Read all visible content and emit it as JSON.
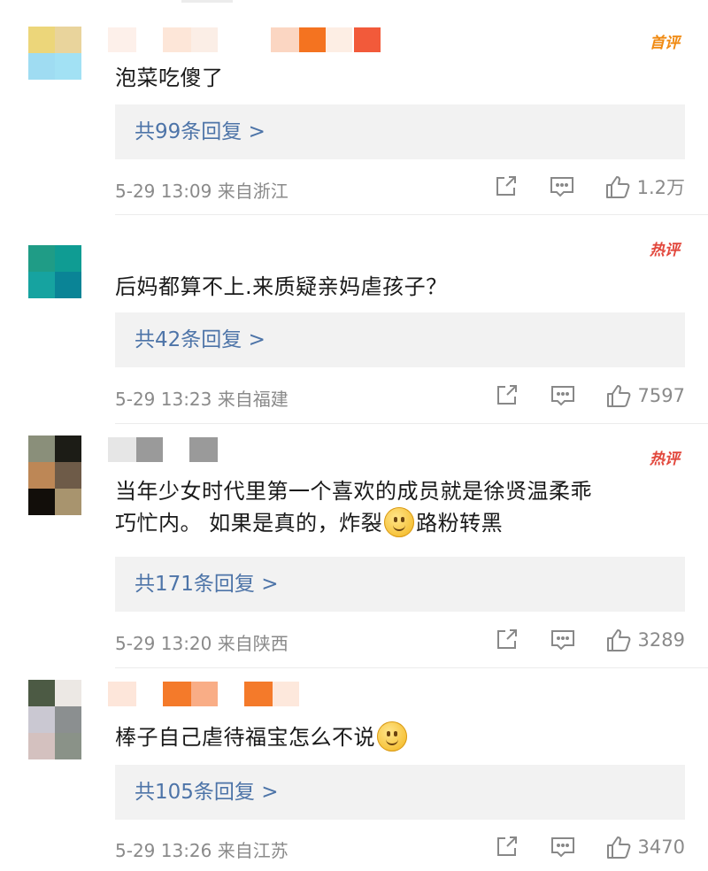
{
  "comments": [
    {
      "badge": "首评",
      "text": "泡菜吃傻了",
      "replies": "共99条回复 >",
      "time": "5-29 13:09 来自浙江",
      "likes": "1.2万"
    },
    {
      "badge": "热评",
      "text": "后妈都算不上.来质疑亲妈虐孩子？",
      "replies": "共42条回复 >",
      "time": "5-29 13:23 来自福建",
      "likes": "7597"
    },
    {
      "badge": "热评",
      "text_line1": "当年少女时代里第一个喜欢的成员就是徐贤温柔乖",
      "text_line2_a": "巧忙内。 如果是真的，炸裂",
      "text_line2_b": "路粉转黑",
      "replies": "共171条回复 >",
      "time": "5-29 13:20 来自陕西",
      "likes": "3289"
    },
    {
      "text": "棒子自己虐待福宝怎么不说",
      "replies": "共105条回复 >",
      "time": "5-29 13:26 来自江苏",
      "likes": "3470"
    }
  ],
  "icons": {
    "share": "share-icon",
    "comment": "comment-icon",
    "like": "thumbs-up-icon",
    "emoji": "smile-emoji-icon"
  },
  "colors": {
    "link": "#4d74a8",
    "badge_first": "#f08a12",
    "badge_hot": "#e2473c",
    "meta": "#8a8a8a"
  }
}
